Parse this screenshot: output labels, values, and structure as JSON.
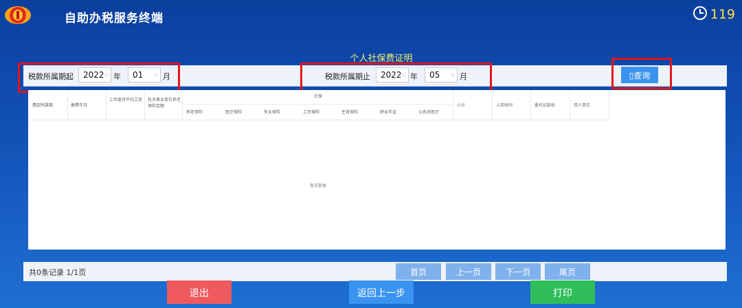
{
  "header": {
    "title": "自助办税服务终端",
    "timer": "119"
  },
  "page": {
    "title": "个人社保费证明"
  },
  "filters": {
    "start_label": "税款所属期起",
    "start_year": "2022",
    "start_month": "01",
    "end_label": "税款所属期止",
    "end_year": "2022",
    "end_month": "05",
    "year_unit": "年",
    "month_unit": "月",
    "query_label": "▯查询"
  },
  "table": {
    "columns": [
      "费款所属期",
      "缴费年月",
      "上年度月平均工资",
      "机关事业单位养老保险金额"
    ],
    "group_label": "社保",
    "sub_columns": [
      "养老保险",
      "医疗保险",
      "失业保险",
      "工伤保险",
      "生育保险",
      "职业年金",
      "公务员医疗"
    ],
    "tail_columns": [
      "小计",
      "入库时间",
      "委托扣款机",
      "用人单位"
    ],
    "empty_text": "暂无数据"
  },
  "footer": {
    "records": "共0条记录  1/1页",
    "first": "首页",
    "prev": "上一页",
    "next": "下一页",
    "last": "尾页"
  },
  "actions": {
    "exit": "退出",
    "back": "返回上一步",
    "print": "打印"
  },
  "colors": {
    "exit": "#ef5a5f",
    "back": "#3a93ef",
    "print": "#2fbe5a",
    "highlight": "#e0141c"
  }
}
